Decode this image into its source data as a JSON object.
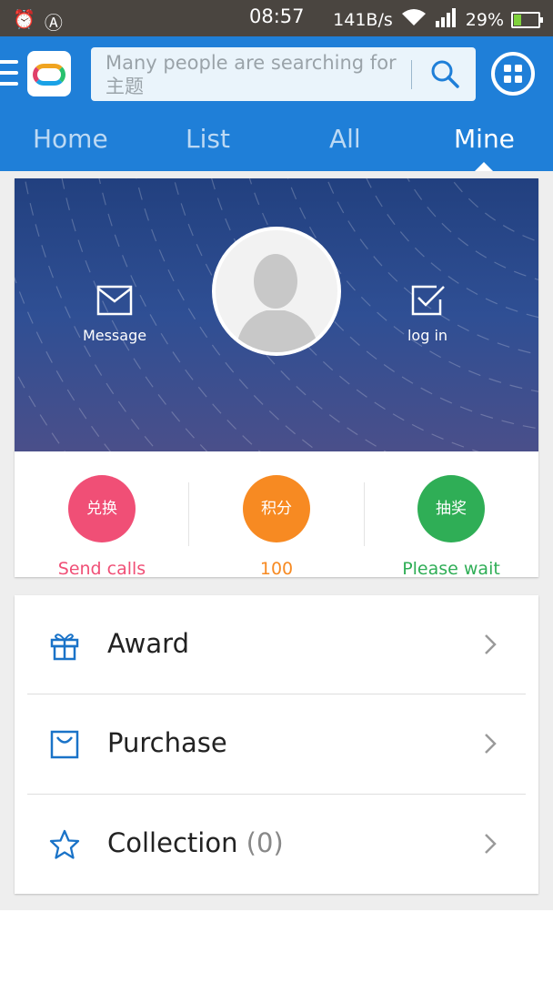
{
  "status_bar": {
    "time": "08:57",
    "speed": "141B/s",
    "battery": "29%",
    "battery_level": 0.29
  },
  "search": {
    "placeholder": "Many people are searching for 主题"
  },
  "tabs": [
    {
      "label": "Home"
    },
    {
      "label": "List"
    },
    {
      "label": "All"
    },
    {
      "label": "Mine",
      "active": true
    }
  ],
  "profile": {
    "message_label": "Message",
    "login_label": "log in"
  },
  "stats": [
    {
      "badge": "兑换",
      "caption": "Send calls",
      "color": "#f04f76"
    },
    {
      "badge": "积分",
      "caption": "100",
      "color": "#f78a22"
    },
    {
      "badge": "抽奖",
      "caption": "Please wait",
      "color": "#2fae56"
    }
  ],
  "menu": {
    "award": "Award",
    "purchase": "Purchase",
    "collection": "Collection",
    "collection_count": "(0)"
  },
  "colors": {
    "primary": "#1f7fd8",
    "icon_blue": "#1a73c8"
  }
}
